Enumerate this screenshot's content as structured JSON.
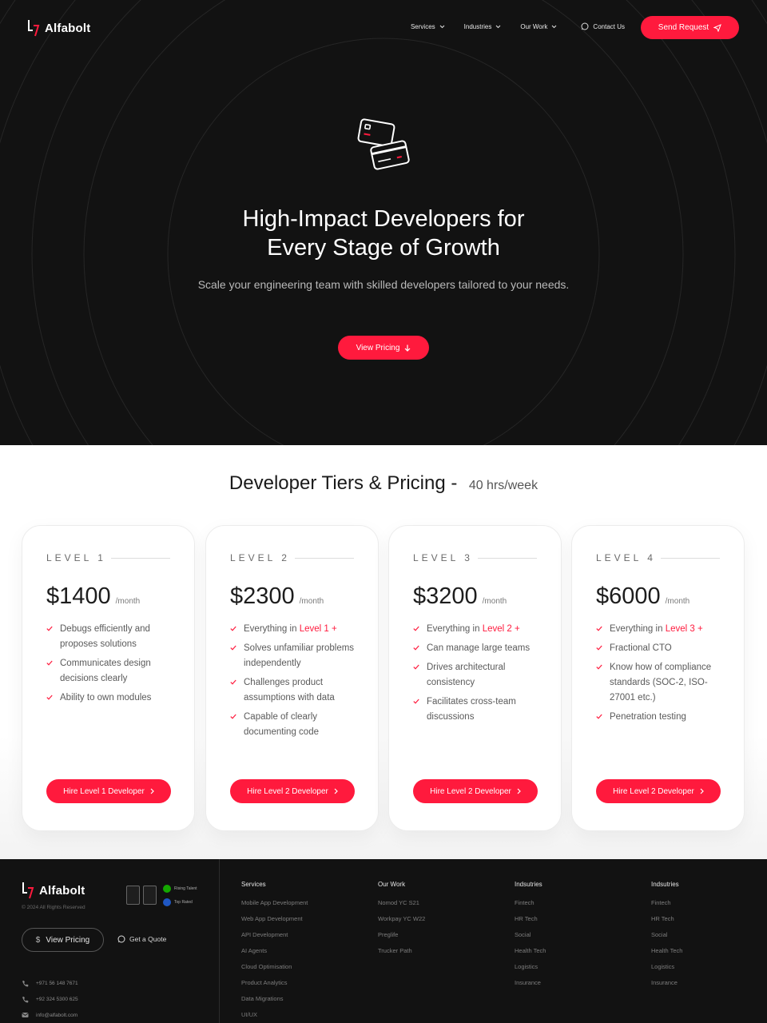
{
  "brand": {
    "name": "Alfabolt",
    "accent": "#ff1a3d",
    "dark_bg": "#121212"
  },
  "nav": {
    "links": [
      {
        "label": "Services",
        "has_dropdown": true
      },
      {
        "label": "Industries",
        "has_dropdown": true
      },
      {
        "label": "Our Work",
        "has_dropdown": true
      }
    ],
    "contact_label": "Contact Us",
    "cta_label": "Send Request"
  },
  "hero": {
    "title_line1": "High-Impact Developers for",
    "title_line2": "Every Stage of Growth",
    "subtitle": "Scale your engineering team with skilled developers tailored to your needs.",
    "cta_label": "View Pricing"
  },
  "pricing": {
    "title": "Developer Tiers & Pricing -",
    "subtitle": "40 hrs/week",
    "tiers": [
      {
        "level": "LEVEL 1",
        "price": "$1400",
        "unit": "/month",
        "features": [
          {
            "text": "Debugs efficiently and proposes solutions"
          },
          {
            "text": "Communicates design decisions clearly"
          },
          {
            "text": "Ability to own modules"
          }
        ],
        "cta": "Hire Level 1 Developer"
      },
      {
        "level": "LEVEL 2",
        "price": "$2300",
        "unit": "/month",
        "features": [
          {
            "prefix": "Everything in ",
            "highlight": "Level 1 +"
          },
          {
            "text": "Solves unfamiliar problems independently"
          },
          {
            "text": "Challenges product assumptions with data"
          },
          {
            "text": "Capable of clearly documenting code"
          }
        ],
        "cta": "Hire Level 2 Developer"
      },
      {
        "level": "LEVEL 3",
        "price": "$3200",
        "unit": "/month",
        "features": [
          {
            "prefix": "Everything in ",
            "highlight": "Level 2 +"
          },
          {
            "text": "Can manage large teams"
          },
          {
            "text": "Drives architectural consistency"
          },
          {
            "text": "Facilitates cross-team discussions"
          }
        ],
        "cta": "Hire Level 2 Developer"
      },
      {
        "level": "LEVEL 4",
        "price": "$6000",
        "unit": "/month",
        "features": [
          {
            "prefix": "Everything in ",
            "highlight": "Level 3 +"
          },
          {
            "text": "Fractional CTO"
          },
          {
            "text": "Know how of compliance standards (SOC-2, ISO-27001 etc.)"
          },
          {
            "text": "Penetration testing"
          }
        ],
        "cta": "Hire Level 2 Developer"
      }
    ]
  },
  "footer": {
    "copyright": "© 2024 All Rights Reserved",
    "ratings": [
      "Rising Talent",
      "Top Rated"
    ],
    "pricing_btn": "View Pricing",
    "quote_label": "Get a Quote",
    "contacts": [
      "+971 56 148 7671",
      "+92 324 5300 625",
      "info@alfabolt.com"
    ],
    "columns": [
      {
        "title": "Services",
        "items": [
          "Mobile App Development",
          "Web App Development",
          "API Development",
          "AI Agents",
          "Cloud Optimisation",
          "Product Analytics",
          "Data Migrations",
          "UI/UX"
        ]
      },
      {
        "title": "Our Work",
        "items": [
          "Nomod YC S21",
          "Workpay YC W22",
          "Preglife",
          "Trucker Path"
        ]
      },
      {
        "title": "Indsutries",
        "items": [
          "Fintech",
          "HR Tech",
          "Social",
          "Health Tech",
          "Logistics",
          "Insurance"
        ]
      },
      {
        "title": "Indsutries",
        "items": [
          "Fintech",
          "HR Tech",
          "Social",
          "Health Tech",
          "Logistics",
          "Insurance"
        ]
      }
    ]
  }
}
